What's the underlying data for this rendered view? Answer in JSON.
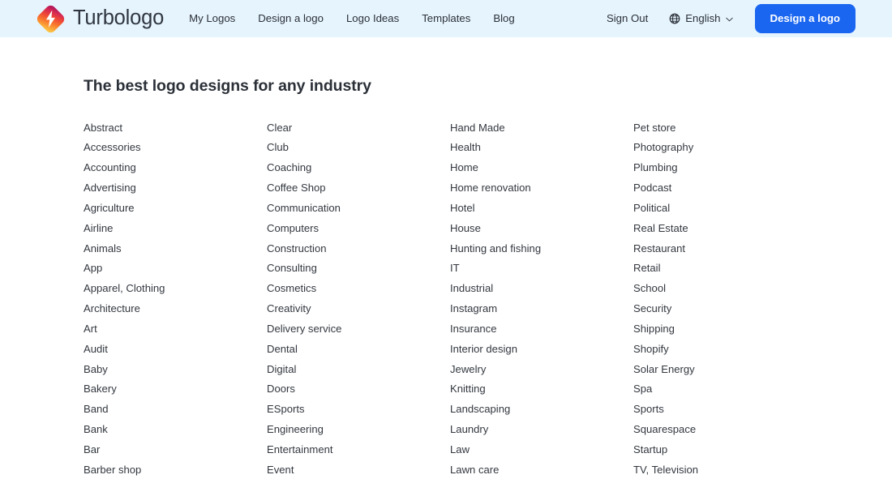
{
  "header": {
    "brand_name": "Turbologo",
    "logo_icon": "turbologo-diamond-bolt-icon",
    "nav": [
      {
        "label": "My Logos"
      },
      {
        "label": "Design a logo"
      },
      {
        "label": "Logo Ideas"
      },
      {
        "label": "Templates"
      },
      {
        "label": "Blog"
      }
    ],
    "sign_out_label": "Sign Out",
    "language": {
      "icon": "globe-icon",
      "label": "English",
      "chevron": "chevron-down-icon"
    },
    "cta_label": "Design a logo",
    "colors": {
      "header_background": "#e6f4fd",
      "cta_background": "#1a66f0",
      "cta_text": "#ffffff",
      "text": "#2b3038",
      "logo_gradient_start": "#c31e5c",
      "logo_gradient_mid": "#f0452f",
      "logo_gradient_end": "#fbb03b"
    }
  },
  "main": {
    "title": "The best logo designs for any industry",
    "columns": [
      {
        "items": [
          "Abstract",
          "Accessories",
          "Accounting",
          "Advertising",
          "Agriculture",
          "Airline",
          "Animals",
          "App",
          "Apparel, Clothing",
          "Architecture",
          "Art",
          "Audit",
          "Baby",
          "Bakery",
          "Band",
          "Bank",
          "Bar",
          "Barber shop"
        ]
      },
      {
        "items": [
          "Clear",
          "Club",
          "Coaching",
          "Coffee Shop",
          "Communication",
          "Computers",
          "Construction",
          "Consulting",
          "Cosmetics",
          "Creativity",
          "Delivery service",
          "Dental",
          "Digital",
          "Doors",
          "ESports",
          "Engineering",
          "Entertainment",
          "Event"
        ]
      },
      {
        "items": [
          "Hand Made",
          "Health",
          "Home",
          "Home renovation",
          "Hotel",
          "House",
          "Hunting and fishing",
          "IT",
          "Industrial",
          "Instagram",
          "Insurance",
          "Interior design",
          "Jewelry",
          "Knitting",
          "Landscaping",
          "Laundry",
          "Law",
          "Lawn care"
        ]
      },
      {
        "items": [
          "Pet store",
          "Photography",
          "Plumbing",
          "Podcast",
          "Political",
          "Real Estate",
          "Restaurant",
          "Retail",
          "School",
          "Security",
          "Shipping",
          "Shopify",
          "Solar Energy",
          "Spa",
          "Sports",
          "Squarespace",
          "Startup",
          "TV, Television"
        ]
      }
    ]
  }
}
